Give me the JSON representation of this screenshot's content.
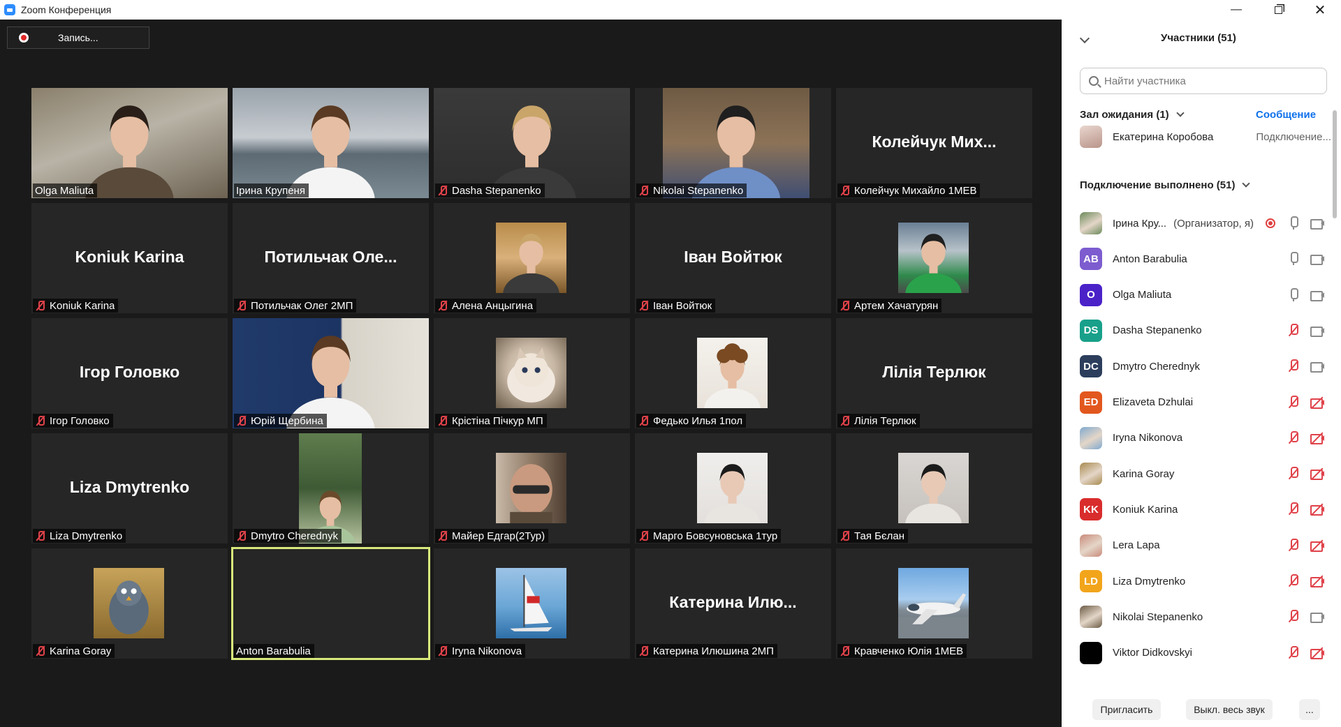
{
  "window": {
    "title": "Zoom Конференция"
  },
  "recording": {
    "label": "Запись..."
  },
  "tiles": [
    {
      "big": "",
      "name": "Olga Maliuta",
      "muted": false,
      "thumb": "full",
      "bg": "linear-gradient(160deg,#8a7f6b 0%,#b8b3a6 45%,#6d6252 100%)",
      "figure": "head"
    },
    {
      "big": "",
      "name": "Ірина Крупеня",
      "muted": false,
      "thumb": "full",
      "bg": "linear-gradient(180deg,#9aa3ab 0%,#c7ccd1 45%,#5d6a73 60%,#7b8a93 100%)",
      "figure": "person"
    },
    {
      "big": "",
      "name": "Dasha Stepanenko",
      "muted": true,
      "thumb": "full",
      "bg": "linear-gradient(180deg,#3a3a3a 0%,#2d2d2d 100%)",
      "figure": "person-light"
    },
    {
      "big": "",
      "name": "Nikolai Stepanenko",
      "muted": true,
      "thumb": "wide",
      "bg": "linear-gradient(180deg,#6e5a44 0%,#8c7357 50%,#3f4e73 100%)",
      "figure": "person-blue"
    },
    {
      "big": "Колейчук Мих...",
      "name": "Колейчук Михайло 1МЕВ",
      "muted": true,
      "thumb": "none"
    },
    {
      "big": "Koniuk Karina",
      "name": "Koniuk Karina",
      "muted": true,
      "thumb": "none"
    },
    {
      "big": "Потильчак Оле...",
      "name": "Потильчак Олег 2МП",
      "muted": true,
      "thumb": "none"
    },
    {
      "big": "",
      "name": "Алена Анцыгина",
      "muted": true,
      "thumb": "center",
      "bg": "linear-gradient(180deg,#b88c4a 0%,#d9b07a 50%,#7a5628 100%)",
      "figure": "person-light"
    },
    {
      "big": "Іван Войтюк",
      "name": "Іван Войтюк",
      "muted": true,
      "thumb": "none"
    },
    {
      "big": "",
      "name": "Артем Хачатурян",
      "muted": true,
      "thumb": "center",
      "bg": "linear-gradient(180deg,#6a7f94 0%,#b7c2c9 40%,#2f8a4c 75%,#4a4a4a 100%)",
      "figure": "person-green"
    },
    {
      "big": "Ігор Головко",
      "name": "Ігор Головко",
      "muted": true,
      "thumb": "none"
    },
    {
      "big": "",
      "name": "Юрій Щербина",
      "muted": true,
      "thumb": "full",
      "bg": "linear-gradient(90deg,#203a6a 0%,#1c3463 55%,#d7d2c8 56%,#e6e2da 100%)",
      "figure": "person"
    },
    {
      "big": "",
      "name": "Крістіна Пічкур МП",
      "muted": true,
      "thumb": "center",
      "bg": "radial-gradient(circle at 50% 45%,#e8ddd0 0%,#c7b7a4 45%,#6b5b4a 100%)",
      "figure": "cat"
    },
    {
      "big": "",
      "name": "Федько Илья 1пол",
      "muted": true,
      "thumb": "center",
      "bg": "linear-gradient(180deg,#f4f1ec 0%,#e8e2da 100%)",
      "figure": "person-curly"
    },
    {
      "big": "Лілія Терлюк",
      "name": "Лілія Терлюк",
      "muted": true,
      "thumb": "none"
    },
    {
      "big": "Liza Dmytrenko",
      "name": "Liza Dmytrenko",
      "muted": true,
      "thumb": "none"
    },
    {
      "big": "",
      "name": "Dmytro Cherednyk",
      "muted": true,
      "thumb": "tall",
      "bg": "linear-gradient(180deg,#5f7d4e 0%,#3e5a35 50%,#b8c4a0 100%)",
      "figure": "person-green-shirt"
    },
    {
      "big": "",
      "name": "Майер Едгар(2Тур)",
      "muted": true,
      "thumb": "center",
      "bg": "linear-gradient(90deg,#c9b9a8 0%,#8f7a66 50%,#4d3e32 100%)",
      "figure": "bald"
    },
    {
      "big": "",
      "name": "Марго Бовсуновська 1тур",
      "muted": true,
      "thumb": "center",
      "bg": "linear-gradient(180deg,#f0eeec 0%,#e2dfdc 100%)",
      "figure": "person-dark"
    },
    {
      "big": "",
      "name": "Тая Бєлан",
      "muted": true,
      "thumb": "center",
      "bg": "linear-gradient(180deg,#d9d6d3 0%,#c6c1bc 100%)",
      "figure": "person-dark"
    },
    {
      "big": "",
      "name": "Karina Goray",
      "muted": true,
      "thumb": "center",
      "bg": "linear-gradient(180deg,#c7a35a 0%,#8a6a2e 100%)",
      "figure": "cartoon"
    },
    {
      "big": "",
      "name": "Anton Barabulia",
      "muted": false,
      "thumb": "none",
      "active": true
    },
    {
      "big": "",
      "name": "Iryna Nikonova",
      "muted": true,
      "thumb": "center",
      "bg": "linear-gradient(180deg,#9cc3e6 0%,#6aa6d6 55%,#2e6fa8 100%)",
      "figure": "sail"
    },
    {
      "big": "Катерина Илю...",
      "name": "Катерина Илюшина 2МП",
      "muted": true,
      "thumb": "none"
    },
    {
      "big": "",
      "name": "Кравченко Юлія 1МЕВ",
      "muted": true,
      "thumb": "center",
      "bg": "linear-gradient(180deg,#6fa8e0 0%,#a9cdef 45%,#7f8a93 60%,#5b646b 100%)",
      "figure": "plane"
    }
  ],
  "panel": {
    "title": "Участники (51)",
    "search_placeholder": "Найти участника",
    "waiting_title": "Зал ожидания (1)",
    "message_label": "Сообщение",
    "waiting": {
      "name": "Екатерина Коробова",
      "status": "Подключение..."
    },
    "joined_title": "Подключение выполнено (51)",
    "participants": [
      {
        "initials": "",
        "name": "Ірина Кру...",
        "role": "(Организатор, я)",
        "color": "#6b8a5a",
        "photo": true,
        "rec": true,
        "mic": "on",
        "cam": "on"
      },
      {
        "initials": "AB",
        "name": "Anton Barabulia",
        "role": "",
        "color": "#7d5ccf",
        "photo": false,
        "rec": false,
        "mic": "on",
        "cam": "on"
      },
      {
        "initials": "O",
        "name": "Olga Maliuta",
        "role": "",
        "color": "#4a22c8",
        "photo": false,
        "rec": false,
        "mic": "on",
        "cam": "on"
      },
      {
        "initials": "DS",
        "name": "Dasha Stepanenko",
        "role": "",
        "color": "#18a08a",
        "photo": false,
        "rec": false,
        "mic": "off",
        "cam": "on"
      },
      {
        "initials": "DC",
        "name": "Dmytro Cherednyk",
        "role": "",
        "color": "#2c3e5c",
        "photo": false,
        "rec": false,
        "mic": "off",
        "cam": "on"
      },
      {
        "initials": "ED",
        "name": "Elizaveta Dzhulai",
        "role": "",
        "color": "#e2571e",
        "photo": false,
        "rec": false,
        "mic": "off",
        "cam": "off"
      },
      {
        "initials": "",
        "name": "Iryna Nikonova",
        "role": "",
        "color": "#7fa9cf",
        "photo": true,
        "rec": false,
        "mic": "off",
        "cam": "off"
      },
      {
        "initials": "",
        "name": "Karina Goray",
        "role": "",
        "color": "#a88a4e",
        "photo": true,
        "rec": false,
        "mic": "off",
        "cam": "off"
      },
      {
        "initials": "KK",
        "name": "Koniuk Karina",
        "role": "",
        "color": "#d92c2c",
        "photo": false,
        "rec": false,
        "mic": "off",
        "cam": "off"
      },
      {
        "initials": "",
        "name": "Lera  Lapa",
        "role": "",
        "color": "#c98a7a",
        "photo": true,
        "rec": false,
        "mic": "off",
        "cam": "off"
      },
      {
        "initials": "LD",
        "name": "Liza Dmytrenko",
        "role": "",
        "color": "#f2a51b",
        "photo": false,
        "rec": false,
        "mic": "off",
        "cam": "off"
      },
      {
        "initials": "",
        "name": "Nikolai Stepanenko",
        "role": "",
        "color": "#6a5a44",
        "photo": true,
        "rec": false,
        "mic": "off",
        "cam": "on"
      },
      {
        "initials": "",
        "name": "Viktor Didkovskyi",
        "role": "",
        "color": "#000000",
        "photo": false,
        "rec": false,
        "mic": "off",
        "cam": "off"
      }
    ],
    "invite_label": "Пригласить",
    "mute_all_label": "Выкл. весь звук",
    "more_label": "..."
  }
}
